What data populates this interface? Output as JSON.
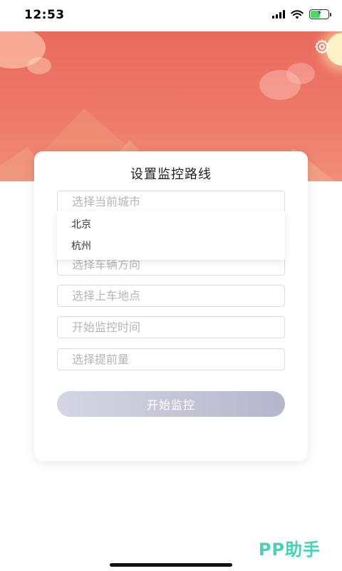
{
  "status_bar": {
    "time": "12:53",
    "icons": [
      "signal-icon",
      "wifi-icon",
      "battery-icon"
    ]
  },
  "banner": {
    "settings_icon": "gear-icon",
    "colors": {
      "top": "#e96a5e",
      "bottom": "#f08d78"
    }
  },
  "form": {
    "title": "设置监控路线",
    "city_placeholder": "选择当前城市",
    "city_options": [
      "北京",
      "杭州"
    ],
    "direction_placeholder": "选择车辆方向",
    "pickup_placeholder": "选择上车地点",
    "time_placeholder": "开始监控时间",
    "advance_placeholder": "选择提前量",
    "start_button": "开始监控"
  },
  "watermark": "PP助手"
}
